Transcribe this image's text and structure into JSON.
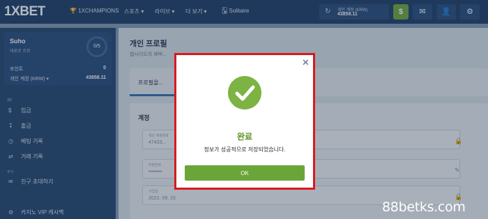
{
  "header": {
    "logo": "1XBET",
    "nav": [
      "1XCHAMPIONS",
      "스포츠",
      "라이브",
      "더 보기"
    ],
    "game": "Solitaire",
    "account_label": "개인 계정 (KRW)",
    "account_balance": "43858.11",
    "deposit_symbol": "$"
  },
  "sidebar": {
    "user_name": "Suho",
    "user_sub": "대표로 조회",
    "ring_value": "0/5",
    "points_label": "포인트",
    "points_value": "0",
    "account_label": "개인 계정 (KRW)",
    "account_value": "43858.11",
    "section_payment": "제2",
    "menu": [
      {
        "icon": "$",
        "label": "입금"
      },
      {
        "icon": "↧",
        "label": "출금"
      },
      {
        "icon": "◷",
        "label": "베팅 기록"
      },
      {
        "icon": "⇄",
        "label": "거래 기록"
      }
    ],
    "section_more": "추가",
    "menu2": [
      {
        "icon": "✉",
        "label": "친구 초대하기"
      },
      {
        "icon": "⚙",
        "label": "카지노 VIP 캐시백"
      }
    ]
  },
  "main": {
    "title": "개인 프로필",
    "subtitle": "웹사이트의 혜택...",
    "tab_label": "프로필을...",
    "panel_title": "계정",
    "fields": [
      {
        "label": "개인 계정번호",
        "value": "47433..."
      },
      {
        "label": "비밀번호",
        "value": "••••••••"
      },
      {
        "label": "가입일",
        "value": "2022. 09. 15"
      }
    ]
  },
  "modal": {
    "title": "완료",
    "message": "정보가 성공적으로 저장되었습니다.",
    "ok_label": "OK",
    "close_symbol": "✕"
  },
  "watermark": "88betks.com",
  "colors": {
    "accent_green": "#6aa53a",
    "check_green": "#7cb342",
    "highlight_red": "#d7191f",
    "nav_blue": "#1a3b66"
  }
}
